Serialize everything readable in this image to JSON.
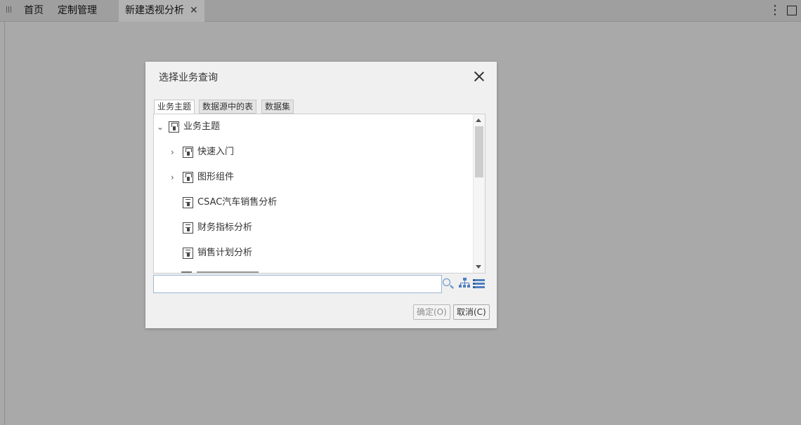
{
  "tabbar": {
    "tabs": [
      {
        "label": "首页"
      },
      {
        "label": "定制管理"
      },
      {
        "label": "新建透视分析",
        "close_glyph": "✕"
      }
    ],
    "more_glyph": "⋮"
  },
  "dialog": {
    "title": "选择业务查询",
    "tabs": [
      {
        "label": "业务主题"
      },
      {
        "label": "数据源中的表"
      },
      {
        "label": "数据集"
      }
    ],
    "tree": {
      "root": {
        "label": "业务主题",
        "expanded": true,
        "icon": "folder-icon"
      },
      "items": [
        {
          "label": "快速入门",
          "type": "folder",
          "expanded": false,
          "icon": "folder-icon"
        },
        {
          "label": "图形组件",
          "type": "folder",
          "expanded": false,
          "icon": "folder-icon"
        },
        {
          "label": "CSAC汽车销售分析",
          "type": "query",
          "icon": "business-query-icon"
        },
        {
          "label": "财务指标分析",
          "type": "query",
          "icon": "business-query-icon"
        },
        {
          "label": "销售计划分析",
          "type": "query",
          "icon": "business-query-icon"
        }
      ]
    },
    "search": {
      "value": "",
      "placeholder": ""
    },
    "buttons": {
      "ok_label": "确定(O)",
      "cancel_label": "取消(C)"
    }
  },
  "colors": {
    "overlay": "#a9a9a9",
    "accent_icon": "#4f7fbf",
    "search_border": "#9fb5d3"
  }
}
